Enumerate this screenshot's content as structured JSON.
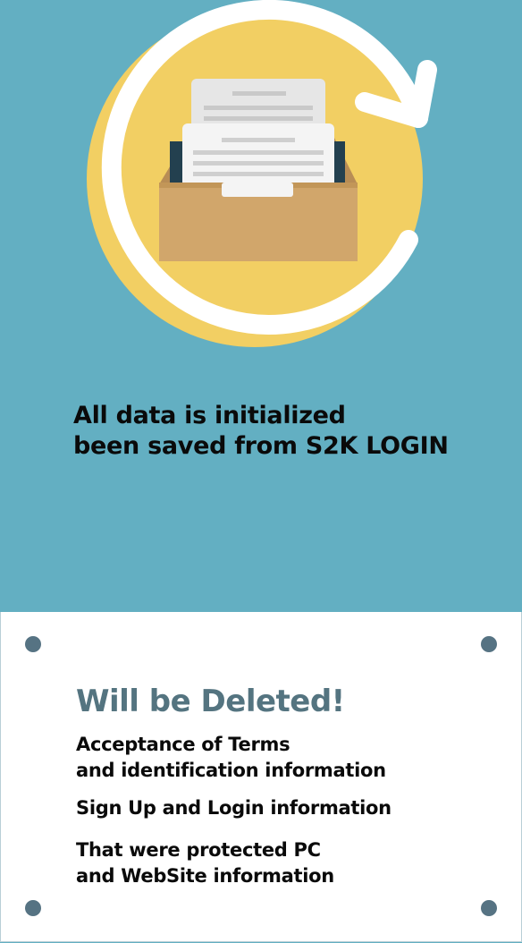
{
  "header": {
    "headline_line1": "All data is initialized",
    "headline_line2": "been saved from S2K LOGIN"
  },
  "illustration": {
    "icon": "file-drawer-refresh-icon",
    "colors": {
      "background": "#63afc2",
      "circle": "#f2cf63",
      "ring": "#ffffff",
      "box": "#d1a66b"
    }
  },
  "notice": {
    "title": "Will be Deleted!",
    "items": [
      {
        "line1": "Acceptance of Terms",
        "line2": "and identification information"
      },
      {
        "line1": "Sign Up and Login information",
        "line2": ""
      },
      {
        "line1": "That were protected PC",
        "line2": "and WebSite information"
      }
    ],
    "title_color": "#547480"
  }
}
